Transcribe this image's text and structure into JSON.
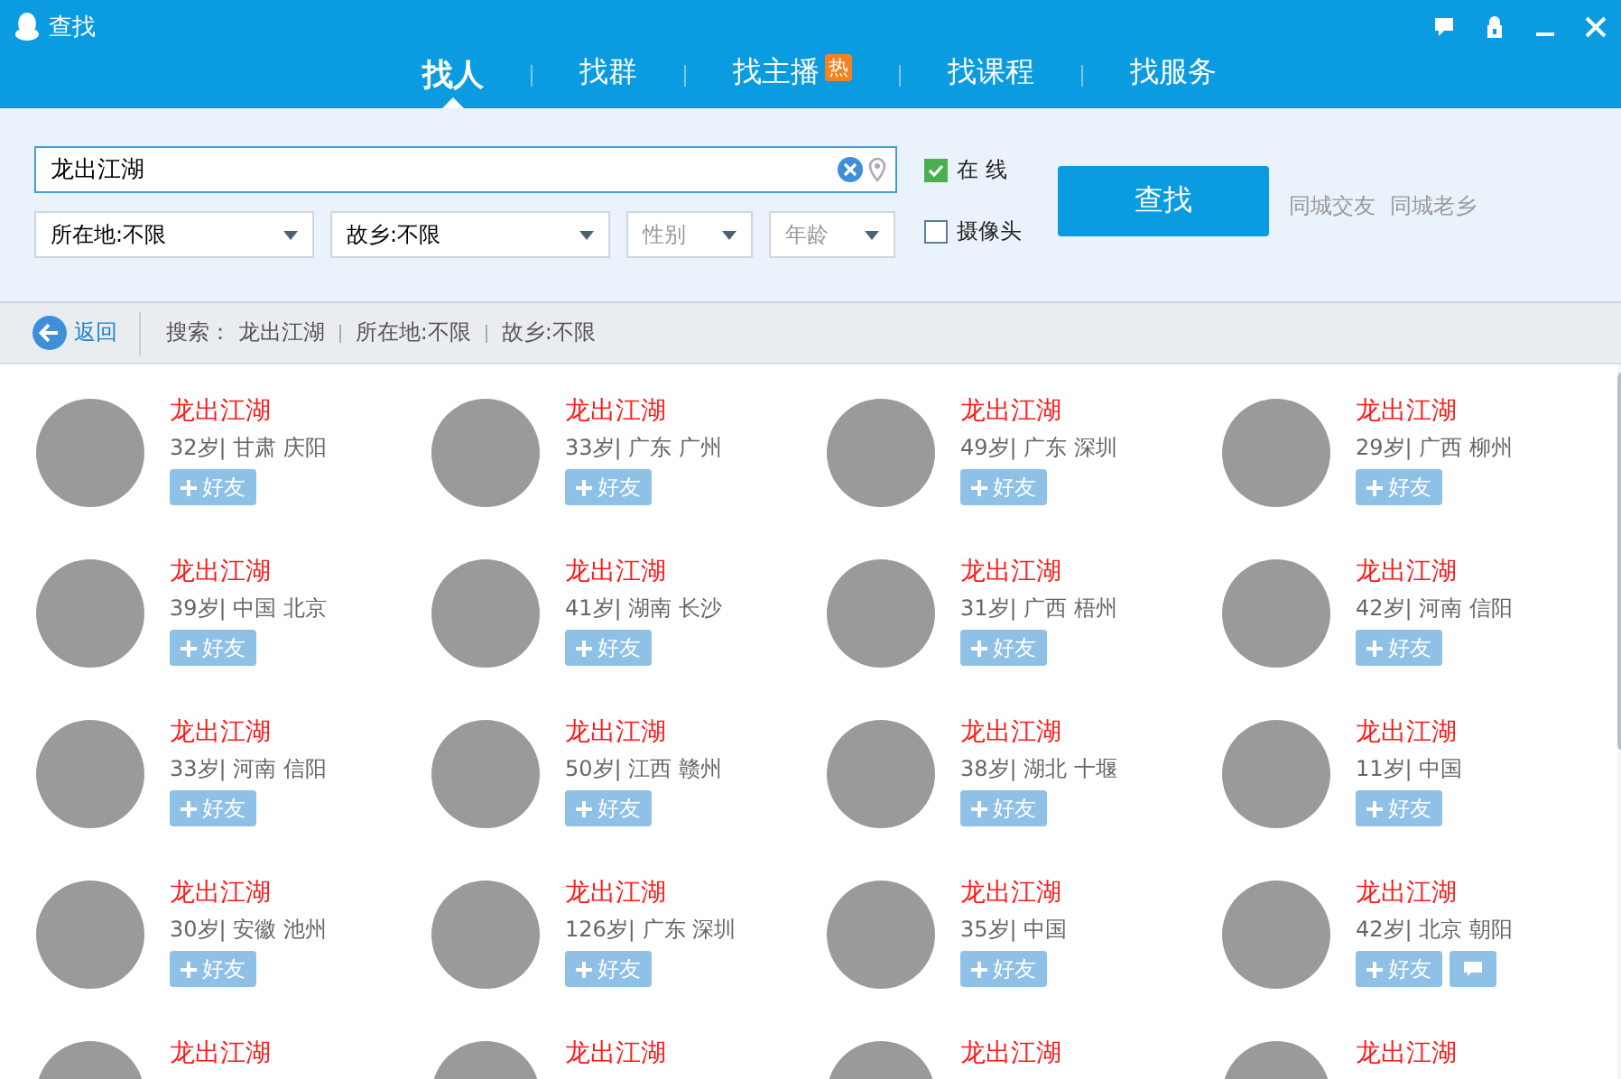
{
  "window": {
    "title": "查找"
  },
  "tabs": [
    {
      "label": "找人",
      "selected": true
    },
    {
      "label": "找群",
      "selected": false
    },
    {
      "label": "找主播",
      "selected": false,
      "badge": "热"
    },
    {
      "label": "找课程",
      "selected": false
    },
    {
      "label": "找服务",
      "selected": false
    }
  ],
  "search": {
    "value": "龙出江湖",
    "filters": [
      {
        "value": "所在地:不限"
      },
      {
        "value": "故乡:不限"
      },
      {
        "placeholder": "性别"
      },
      {
        "placeholder": "年龄"
      }
    ],
    "options": [
      {
        "label": "在 线",
        "checked": true
      },
      {
        "label": "摄像头",
        "checked": false
      }
    ],
    "button": "查找",
    "links": [
      "同城交友",
      "同城老乡"
    ]
  },
  "breadcrumb": {
    "back": "返回",
    "items": [
      "搜索： 龙出江湖",
      "所在地:不限",
      "故乡:不限"
    ]
  },
  "results": [
    {
      "name": "龙出江湖",
      "info": "32岁| 甘肃 庆阳",
      "add": "好友",
      "chat": false
    },
    {
      "name": "龙出江湖",
      "info": "33岁| 广东 广州",
      "add": "好友",
      "chat": false
    },
    {
      "name": "龙出江湖",
      "info": "49岁| 广东 深圳",
      "add": "好友",
      "chat": false
    },
    {
      "name": "龙出江湖",
      "info": "29岁| 广西 柳州",
      "add": "好友",
      "chat": false
    },
    {
      "name": "龙出江湖",
      "info": "39岁| 中国 北京",
      "add": "好友",
      "chat": false
    },
    {
      "name": "龙出江湖",
      "info": "41岁| 湖南 长沙",
      "add": "好友",
      "chat": false
    },
    {
      "name": "龙出江湖",
      "info": "31岁| 广西 梧州",
      "add": "好友",
      "chat": false
    },
    {
      "name": "龙出江湖",
      "info": "42岁| 河南 信阳",
      "add": "好友",
      "chat": false
    },
    {
      "name": "龙出江湖",
      "info": "33岁| 河南 信阳",
      "add": "好友",
      "chat": false
    },
    {
      "name": "龙出江湖",
      "info": "50岁| 江西 赣州",
      "add": "好友",
      "chat": false
    },
    {
      "name": "龙出江湖",
      "info": "38岁| 湖北 十堰",
      "add": "好友",
      "chat": false
    },
    {
      "name": "龙出江湖",
      "info": "11岁| 中国",
      "add": "好友",
      "chat": false
    },
    {
      "name": "龙出江湖",
      "info": "30岁| 安徽 池州",
      "add": "好友",
      "chat": false
    },
    {
      "name": "龙出江湖",
      "info": "126岁| 广东 深圳",
      "add": "好友",
      "chat": false
    },
    {
      "name": "龙出江湖",
      "info": "35岁| 中国",
      "add": "好友",
      "chat": false
    },
    {
      "name": "龙出江湖",
      "info": "42岁| 北京 朝阳",
      "add": "好友",
      "chat": true
    },
    {
      "name": "龙出江湖"
    },
    {
      "name": "龙出江湖"
    },
    {
      "name": "龙出江湖"
    },
    {
      "name": "龙出江湖"
    }
  ]
}
